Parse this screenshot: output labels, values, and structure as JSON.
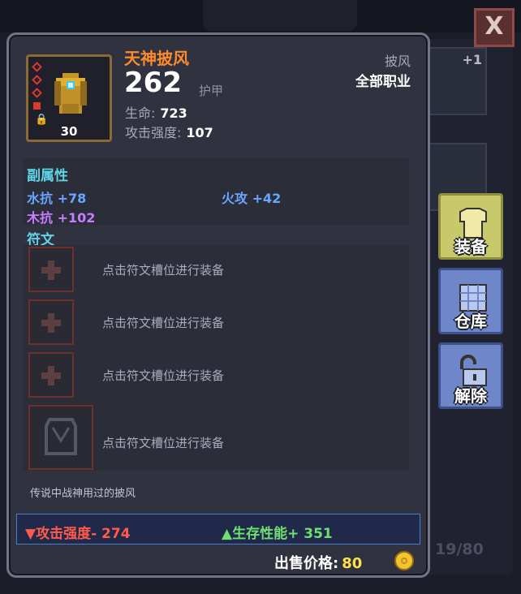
{
  "background": {
    "close_label": "X",
    "slot_badge": "+1",
    "inventory_count": "19/80"
  },
  "item": {
    "name": "天神披风",
    "level": "30",
    "score": "262",
    "score_label": "护甲",
    "type": "披风",
    "class": "全部职业",
    "stats": [
      {
        "label": "生命:",
        "value": "723"
      },
      {
        "label": "攻击强度:",
        "value": "107"
      }
    ],
    "description": "传说中战神用过的披风"
  },
  "affixes": {
    "title": "副属性",
    "items": [
      {
        "text": "水抗 +78",
        "color": "#6aa6ff"
      },
      {
        "text": "火攻 +42",
        "color": "#6aa6ff"
      },
      {
        "text": "木抗 +102",
        "color": "#c77dff"
      }
    ]
  },
  "runes": {
    "title": "符文",
    "slots": [
      {
        "hint": "点击符文槽位进行装备"
      },
      {
        "hint": "点击符文槽位进行装备"
      },
      {
        "hint": "点击符文槽位进行装备"
      },
      {
        "hint": "点击符文槽位进行装备"
      }
    ]
  },
  "compare": {
    "attack": "▼攻击强度- 274",
    "survival": "▲生存性能+ 351",
    "attack_color": "#ff5a4a",
    "survival_color": "#6fe06f"
  },
  "sell": {
    "label": "出售价格:",
    "value": "80"
  },
  "actions": {
    "equip": "装备",
    "storage": "仓库",
    "unbind": "解除"
  }
}
